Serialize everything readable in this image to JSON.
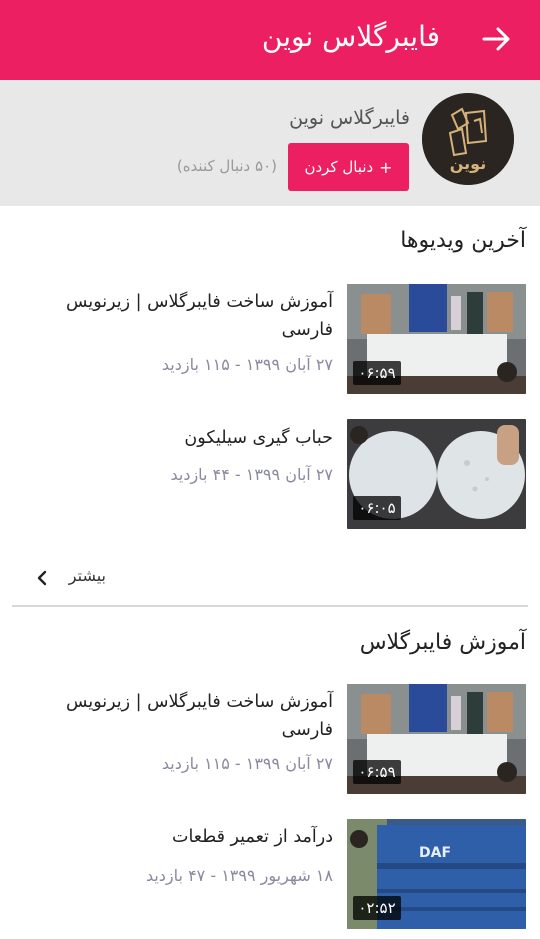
{
  "header": {
    "title": "فایبرگلاس نوین",
    "back_icon": "arrow-right-icon",
    "color": "#ec1f63"
  },
  "channel": {
    "name": "فایبرگلاس نوین",
    "follow_label": "دنبال کردن",
    "followers": "(۵۰ دنبال کننده)",
    "avatar_text": "نوین",
    "avatar_icon": "channel-logo"
  },
  "latest": {
    "title": "آخرین ویدیوها",
    "videos": [
      {
        "title": "آموزش ساخت فایبرگلاس | زیرنویس فارسی",
        "meta": "۲۷ آبان ۱۳۹۹ - ۱۱۵ بازدید",
        "duration": "۰۶:۵۹"
      },
      {
        "title": "حباب گیری سیلیکون",
        "meta": "۲۷ آبان ۱۳۹۹ - ۴۴ بازدید",
        "duration": "۰۶:۰۵"
      }
    ],
    "more_label": "بیشتر"
  },
  "fiberglass": {
    "title": "آموزش فایبرگلاس",
    "videos": [
      {
        "title": "آموزش ساخت فایبرگلاس | زیرنویس فارسی",
        "meta": "۲۷ آبان ۱۳۹۹ - ۱۱۵ بازدید",
        "duration": "۰۶:۵۹"
      },
      {
        "title": "درآمد از تعمیر قطعات",
        "meta": "۱۸ شهریور ۱۳۹۹ - ۴۷ بازدید",
        "duration": "۰۲:۵۲",
        "thumb_text": "DAF"
      }
    ]
  }
}
